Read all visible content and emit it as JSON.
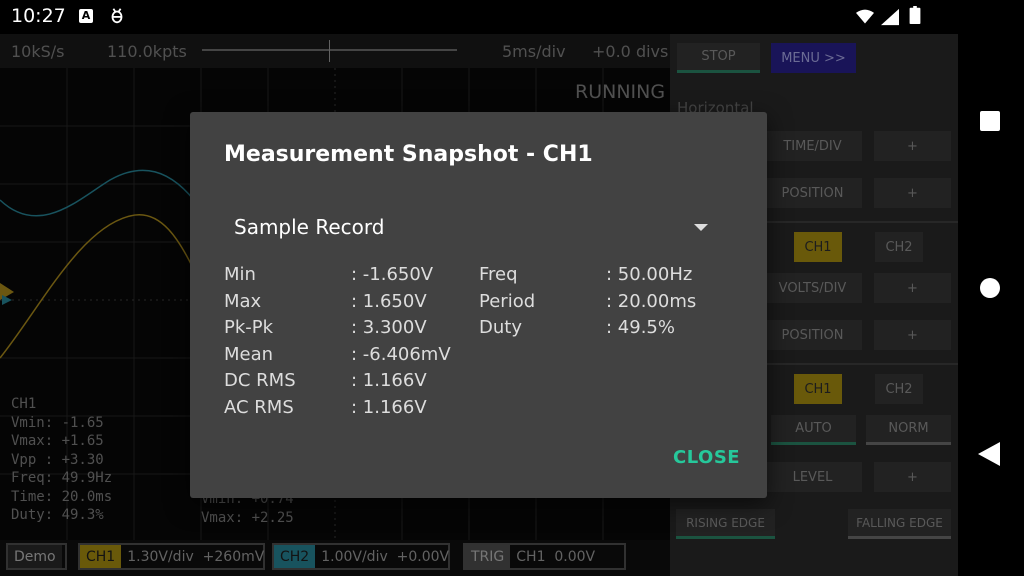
{
  "status_bar": {
    "time": "10:27",
    "icons": [
      "notification-a-icon",
      "bug-icon",
      "wifi-icon",
      "signal-icon",
      "battery-icon"
    ]
  },
  "scope": {
    "sample_rate": "10kS/s",
    "points": "110.0kpts",
    "timebase": "5ms/div",
    "offset": "+0.0 divs",
    "state": "RUNNING",
    "ch1_readout": {
      "label": "CH1",
      "lines": [
        "Vmin: -1.65",
        "Vmax: +1.65",
        "Vpp : +3.30",
        "Freq: 49.9Hz",
        "Time: 20.0ms",
        "Duty: 49.3%"
      ]
    },
    "ch2_readout": {
      "lines": [
        "Vmin: +0.74",
        "Vmax: +2.25"
      ]
    },
    "colors": {
      "ch1": "#b8971e",
      "ch2": "#2a8fa3"
    }
  },
  "bottom_bar": {
    "mode": "Demo",
    "ch1_tag": "CH1",
    "ch1_settings": "1.30V/div  +260mV",
    "ch2_tag": "CH2",
    "ch2_settings": "1.00V/div  +0.00V",
    "trig_tag": "TRIG",
    "trig_settings": "CH1  0.00V"
  },
  "panel": {
    "stop": "STOP",
    "menu": "MENU >>",
    "horizontal_label": "Horizontal",
    "time_div": "TIME/DIV",
    "h_position": "POSITION",
    "plus": "+",
    "ch1": "CH1",
    "ch2": "CH2",
    "volts_div": "VOLTS/DIV",
    "v_position": "POSITION",
    "auto": "AUTO",
    "norm": "NORM",
    "level": "LEVEL",
    "rising": "RISING EDGE",
    "falling": "FALLING EDGE"
  },
  "dialog": {
    "title": "Measurement Snapshot - CH1",
    "selected_record": "Sample Record",
    "left_measurements": [
      {
        "label": "Min",
        "value": ": -1.650V"
      },
      {
        "label": "Max",
        "value": ": 1.650V"
      },
      {
        "label": "Pk-Pk",
        "value": ": 3.300V"
      },
      {
        "label": "Mean",
        "value": ": -6.406mV"
      },
      {
        "label": "DC RMS",
        "value": ": 1.166V"
      },
      {
        "label": "AC RMS",
        "value": ": 1.166V"
      }
    ],
    "right_measurements": [
      {
        "label": "Freq",
        "value": ": 50.00Hz"
      },
      {
        "label": "Period",
        "value": ": 20.00ms"
      },
      {
        "label": "Duty",
        "value": ": 49.5%"
      }
    ],
    "close_label": "CLOSE",
    "accent": "#26c89b"
  }
}
